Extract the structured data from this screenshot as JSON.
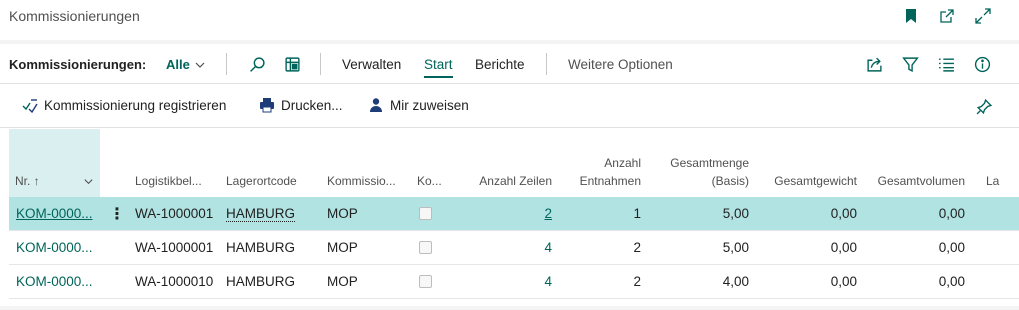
{
  "page": {
    "title": "Kommissionierungen"
  },
  "actionbar": {
    "caption": "Kommissionierungen:",
    "view": "Alle",
    "menus": [
      "Verwalten",
      "Start",
      "Berichte"
    ],
    "more": "Weitere Optionen"
  },
  "promoted": {
    "register": "Kommissionierung registrieren",
    "print": "Drucken...",
    "assign": "Mir zuweisen"
  },
  "grid": {
    "headers": {
      "nr": "Nr. ↑",
      "logistik": "Logistikbel...",
      "lagerort": "Lagerortcode",
      "kommission": "Kommissio...",
      "ko": "Ko...",
      "anzahl_zeilen": "Anzahl Zeilen",
      "anzahl_entnahmen_1": "Anzahl",
      "anzahl_entnahmen_2": "Entnahmen",
      "gesamtmenge_1": "Gesamtmenge",
      "gesamtmenge_2": "(Basis)",
      "gesamtgewicht": "Gesamtgewicht",
      "gesamtvolumen": "Gesamtvolumen",
      "la": "La"
    },
    "rows": [
      {
        "nr": "KOM-0000...",
        "logistik": "WA-1000001",
        "lagerort": "HAMBURG",
        "kommission": "MOP",
        "zeilen": "2",
        "entnahmen": "1",
        "menge": "5,00",
        "gewicht": "0,00",
        "volumen": "0,00"
      },
      {
        "nr": "KOM-0000...",
        "logistik": "WA-1000001",
        "lagerort": "HAMBURG",
        "kommission": "MOP",
        "zeilen": "4",
        "entnahmen": "2",
        "menge": "5,00",
        "gewicht": "0,00",
        "volumen": "0,00"
      },
      {
        "nr": "KOM-0000...",
        "logistik": "WA-1000010",
        "lagerort": "HAMBURG",
        "kommission": "MOP",
        "zeilen": "4",
        "entnahmen": "2",
        "menge": "4,00",
        "gewicht": "0,00",
        "volumen": "0,00"
      }
    ],
    "selected_row": 0
  },
  "colors": {
    "accent": "#00645a",
    "selected_row": "#b1e3e3",
    "header_highlight": "#daf0f0"
  },
  "icons": [
    "bookmark-icon",
    "open-new-window-icon",
    "expand-icon",
    "chevron-down-icon",
    "search-icon",
    "edit-list-icon",
    "share-icon",
    "filter-icon",
    "list-icon",
    "info-icon",
    "register-icon",
    "print-icon",
    "person-icon",
    "personalize-pin-icon",
    "sort-ascending-icon",
    "row-menu-icon"
  ]
}
